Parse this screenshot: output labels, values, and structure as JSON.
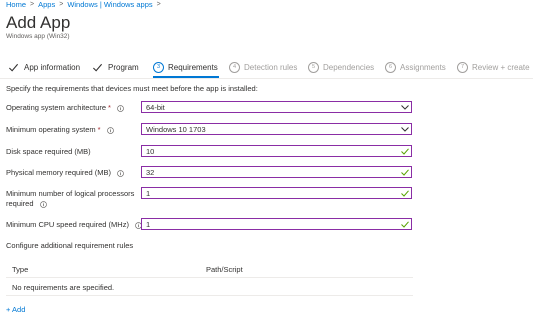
{
  "breadcrumb": {
    "home": "Home",
    "apps": "Apps",
    "windows": "Windows | Windows apps",
    "sep": ">"
  },
  "header": {
    "title": "Add App",
    "subtitle": "Windows app (Win32)"
  },
  "tabs": [
    {
      "label": "App information",
      "state": "done"
    },
    {
      "label": "Program",
      "state": "done"
    },
    {
      "num": "3",
      "label": "Requirements",
      "state": "active"
    },
    {
      "num": "4",
      "label": "Detection rules",
      "state": "future"
    },
    {
      "num": "5",
      "label": "Dependencies",
      "state": "future"
    },
    {
      "num": "6",
      "label": "Assignments",
      "state": "future"
    },
    {
      "num": "7",
      "label": "Review + create",
      "state": "future"
    }
  ],
  "intro": "Specify the requirements that devices must meet before the app is installed:",
  "form": {
    "os_arch": {
      "label": "Operating system architecture",
      "required": "*",
      "value": "64-bit"
    },
    "min_os": {
      "label": "Minimum operating system",
      "required": "*",
      "value": "Windows 10 1703"
    },
    "disk": {
      "label": "Disk space required (MB)",
      "value": "10"
    },
    "memory": {
      "label": "Physical memory required (MB)",
      "value": "32"
    },
    "processors": {
      "label_line1": "Minimum number of logical processors",
      "label_line2": "required",
      "value": "1"
    },
    "cpu": {
      "label": "Minimum CPU speed required (MHz)",
      "value": "1"
    }
  },
  "configure_text": "Configure additional requirement rules",
  "table": {
    "col_type": "Type",
    "col_path": "Path/Script",
    "empty": "No requirements are specified."
  },
  "add_link": "+ Add",
  "colors": {
    "accent": "#0078d4",
    "field_border": "#8a2da5",
    "valid_check": "#57a300"
  }
}
